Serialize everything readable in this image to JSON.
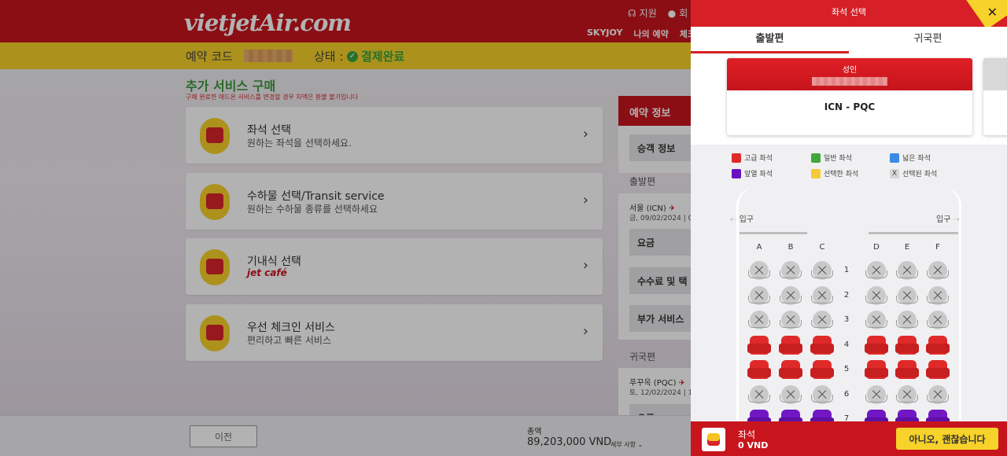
{
  "header": {
    "logo": "vietjetAir.com",
    "support": "지원",
    "user": "회",
    "nav": [
      "SKYJOY",
      "나의 예약",
      "체크"
    ]
  },
  "booking_bar": {
    "code_label": "예약 코드",
    "status_label": "상태 :",
    "status_value": "결제완료"
  },
  "services": {
    "title": "추가 서비스 구매",
    "note": "구매 완료한 애드온 서비스를 변경할 경우 차액은 환불 불가입니다",
    "items": [
      {
        "title": "좌석 선택",
        "subtitle": "원하는 좌석을 선택하세요."
      },
      {
        "title": "수하물 선택/Transit service",
        "subtitle": "원하는 수하물 종류를 선택하세요"
      },
      {
        "title": "기내식 선택",
        "subtitle": "jet café"
      },
      {
        "title": "우선 체크인 서비스",
        "subtitle": "편리하고 빠른 서비스"
      }
    ]
  },
  "sidebar": {
    "title": "예약 정보",
    "passenger_info": "승객 정보",
    "outbound_label": "출발편",
    "outbound_route": "서울 (ICN)",
    "outbound_date": "금, 09/02/2024 | 0",
    "fare": "요금",
    "fees": "수수료 및 택",
    "addons": "부가 서비스",
    "return_label": "귀국편",
    "return_route": "푸꾸옥 (PQC)",
    "return_date": "토, 12/02/2024 | 1",
    "fare2": "요금"
  },
  "footer": {
    "prev": "이전",
    "total_label": "총액",
    "total_value": "89,203,000 VND",
    "details": "세부 사항"
  },
  "panel": {
    "title": "좌석 선택",
    "close": "✕",
    "tabs": [
      "출발편",
      "귀국편"
    ],
    "passenger_type": "성인",
    "route": "ICN - PQC",
    "legend": [
      {
        "label": "고급 좌석",
        "color": "#e02a2a"
      },
      {
        "label": "일반 좌석",
        "color": "#3fa83a"
      },
      {
        "label": "넓은 좌석",
        "color": "#3b8ae6"
      },
      {
        "label": "앞열 좌석",
        "color": "#6a12c0"
      },
      {
        "label": "선택한 좌석",
        "color": "#f5c93a"
      },
      {
        "label": "선택된 좌석",
        "color": "#d6d6d6",
        "mark": "X"
      }
    ],
    "exit_left": "입구",
    "exit_right": "입구",
    "columns": [
      "A",
      "B",
      "C",
      "D",
      "E",
      "F"
    ],
    "rows": [
      {
        "num": "1",
        "type": "taken"
      },
      {
        "num": "2",
        "type": "taken"
      },
      {
        "num": "3",
        "type": "taken"
      },
      {
        "num": "4",
        "type": "premium"
      },
      {
        "num": "5",
        "type": "premium"
      },
      {
        "num": "6",
        "type": "taken"
      },
      {
        "num": "7",
        "type": "front"
      }
    ],
    "footer_label": "좌석",
    "footer_price": "0 VND",
    "decline_button": "아니오, 괜찮습니다"
  }
}
